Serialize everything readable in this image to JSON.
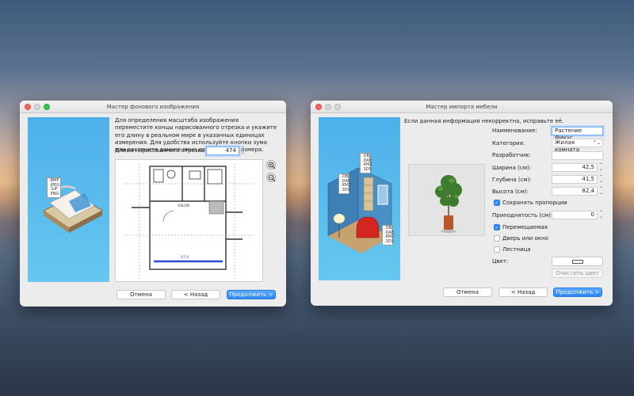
{
  "bg_wizard": {
    "title": "Мастер фонового изображения",
    "instructions": "Для определения масштаба изображения переместите концы нарисованного отрезка и укажите его длину в реальном мире в указанных единицах измерения. Для удобства используйте кнопки зума или растяните данное окно до большего размера.",
    "length_label": "Длина нарисованного отрезка (см):",
    "length_value": "474",
    "formats": [
      ".BMP",
      ".JPEG",
      ".GIF",
      ".PNG"
    ],
    "plan_labels": [
      "SALON",
      "47.4"
    ],
    "cancel": "Отмена",
    "back": "< Назад",
    "continue": "Продолжить >",
    "zoom_in_icon": "zoom-in-icon",
    "zoom_out_icon": "zoom-out-icon"
  },
  "furniture_wizard": {
    "title": "Мастер импорта мебели",
    "prompt": "Если данная информация некорректна, исправьте её.",
    "tags_left": [
      ".OBJ",
      ".DAE",
      ".KMZ",
      ".3DS"
    ],
    "tags_top": [
      ".OBJ",
      ".DAE",
      ".KMZ",
      ".3DS"
    ],
    "tags_bottom": [
      ".OBJ",
      ".DAE",
      ".KMZ",
      ".3DS"
    ],
    "name_label": "Наименование:",
    "name_value": "Растение Фикус",
    "category_label": "Категория:",
    "category_value": "Жилая комната",
    "creator_label": "Разработчик:",
    "creator_value": "",
    "width_label": "Ширина (см):",
    "width_value": "42,5",
    "depth_label": "Глубина (см):",
    "depth_value": "41,5",
    "height_label": "Высота (см):",
    "height_value": "82,4",
    "keep_proportions": "Сохранять пропорции",
    "elevation_label": "Приподнятость (см):",
    "elevation_value": "0",
    "movable": "Перемещаемая",
    "door_window": "Дверь или окно",
    "staircase": "Лестница",
    "color_label": "Цвет:",
    "clear_color": "Очистить цвет",
    "cancel": "Отмена",
    "back": "< Назад",
    "continue": "Продолжить >",
    "accent": "#2b86f5"
  }
}
